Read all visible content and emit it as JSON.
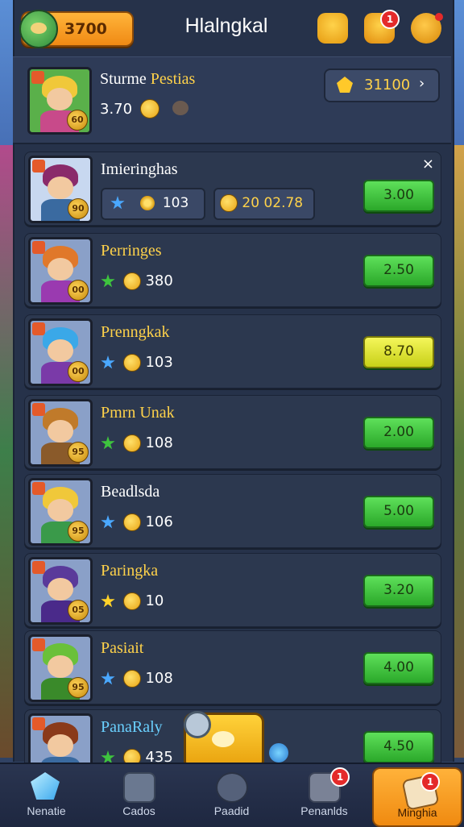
{
  "top_bar": {
    "currency_value": "3700",
    "title": "Hlalngkal",
    "chat_badge": "1"
  },
  "header_card": {
    "name_part1": "Sturme",
    "name_part2": "Pestias",
    "value": "3.70",
    "level": "60",
    "pill_value": "31100",
    "pill_close": "›"
  },
  "featured": {
    "name": "Imieringhas",
    "level": "90",
    "stat1": "103",
    "stat2": "20 02.78",
    "button": "3.00",
    "close": "×",
    "name_color": "#ffffff"
  },
  "rows": [
    {
      "name": "Perringes",
      "stat": "380",
      "level": "00",
      "button": "2.50",
      "button_style": "green",
      "name_color": "#ffd24a",
      "icon": "star-green",
      "hair": "#e0782a",
      "body": "#9a3ab0"
    },
    {
      "name": "Prenngkak",
      "stat": "103",
      "level": "00",
      "button": "8.70",
      "button_style": "yellow",
      "name_color": "#ffd24a",
      "icon": "star-blue",
      "hair": "#3aa8e8",
      "body": "#7a3aa8"
    },
    {
      "name": "Pmrn Unak",
      "stat": "108",
      "level": "95",
      "button": "2.00",
      "button_style": "green",
      "name_color": "#ffd24a",
      "icon": "star-green",
      "hair": "#c07a2a",
      "body": "#8a5a2a"
    },
    {
      "name": "Beadlsda",
      "stat": "106",
      "level": "95",
      "button": "5.00",
      "button_style": "green",
      "name_color": "#ffffff",
      "icon": "star-blue",
      "hair": "#f0c83a",
      "body": "#3a9a4a"
    },
    {
      "name": "Paringka",
      "stat": "10",
      "level": "05",
      "button": "3.20",
      "button_style": "green",
      "name_color": "#ffd24a",
      "icon": "star-icon",
      "hair": "#5a3a9a",
      "body": "#4a2a8a"
    },
    {
      "name": "Pasiait",
      "stat": "108",
      "level": "95",
      "button": "4.00",
      "button_style": "green",
      "name_color": "#ffd24a",
      "icon": "star-blue",
      "hair": "#6ac03a",
      "body": "#3a8a2a"
    },
    {
      "name": "PanaRaly",
      "stat": "435",
      "level": "",
      "button": "4.50",
      "button_style": "green",
      "name_color": "#6ad0ff",
      "icon": "star-green",
      "hair": "#8a3a1a",
      "body": "#3a6aa0"
    }
  ],
  "bottom_nav": [
    {
      "label": "Nenatie",
      "icon": "gem-icon",
      "badge": ""
    },
    {
      "label": "Cados",
      "icon": "cards-icon",
      "badge": ""
    },
    {
      "label": "Paadid",
      "icon": "lock-icon",
      "badge": ""
    },
    {
      "label": "Penanlds",
      "icon": "chest-icon",
      "badge": "1"
    },
    {
      "label": "Minghia",
      "icon": "letter-icon",
      "badge": "1"
    }
  ]
}
